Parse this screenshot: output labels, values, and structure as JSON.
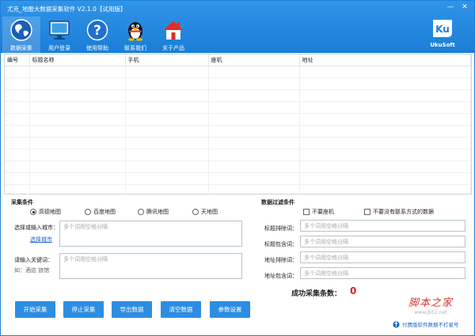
{
  "window": {
    "title": "尤克_地图大数据采集软件 V2.1.0【试用版】",
    "minimize_glyph": "—",
    "close_glyph": "✕"
  },
  "toolbar": {
    "items": [
      {
        "label": "数据采集",
        "icon": "globe-icon"
      },
      {
        "label": "用户登录",
        "icon": "monitor-icon"
      },
      {
        "label": "使用帮助",
        "icon": "help-icon"
      },
      {
        "label": "联系我们",
        "icon": "penguin-icon"
      },
      {
        "label": "关于产品",
        "icon": "home-icon"
      }
    ],
    "active_index": 0
  },
  "brand": {
    "logo_text": "Ku",
    "name": "UkuSoft"
  },
  "table": {
    "columns": [
      "编号",
      "标题名称",
      "手机",
      "座机",
      "地址"
    ],
    "rows": []
  },
  "collect": {
    "title": "采集条件",
    "sources": [
      "高德地图",
      "百度地图",
      "腾讯地图",
      "天地图"
    ],
    "selected_source": 0,
    "city_label": "选择或输入城市：",
    "city_link": "选择城市",
    "city_placeholder": "多个词用空格分隔",
    "keyword_label": "请输入关键词：",
    "keyword_hint": "如：酒店 旅馆",
    "keyword_placeholder": "多个词用空格分隔"
  },
  "filter": {
    "title": "数据过滤条件",
    "no_landline": "不要座机",
    "no_contact": "不要没有联系方式的数据",
    "fields": [
      {
        "label": "标题排除词：",
        "placeholder": "多个词用空格分隔"
      },
      {
        "label": "标题包含词：",
        "placeholder": "多个词用空格分隔"
      },
      {
        "label": "地址排除词：",
        "placeholder": "多个词用空格分隔"
      },
      {
        "label": "地址包含词：",
        "placeholder": "多个词用空格分隔"
      }
    ]
  },
  "actions": {
    "start": "开始采集",
    "stop": "停止采集",
    "export": "导出数据",
    "clear": "清空数据",
    "settings": "参数设置"
  },
  "status": {
    "count_label": "成功采集条数：",
    "count_value": "0"
  },
  "watermark": {
    "main": "脚本之家",
    "sub": "www.jb51.net"
  },
  "notice": {
    "text": "付费版软件数据不打星号"
  },
  "colors": {
    "accent": "#1b7dd6",
    "button": "#2d8de2",
    "count": "#e02020",
    "link": "#1c63c5"
  }
}
